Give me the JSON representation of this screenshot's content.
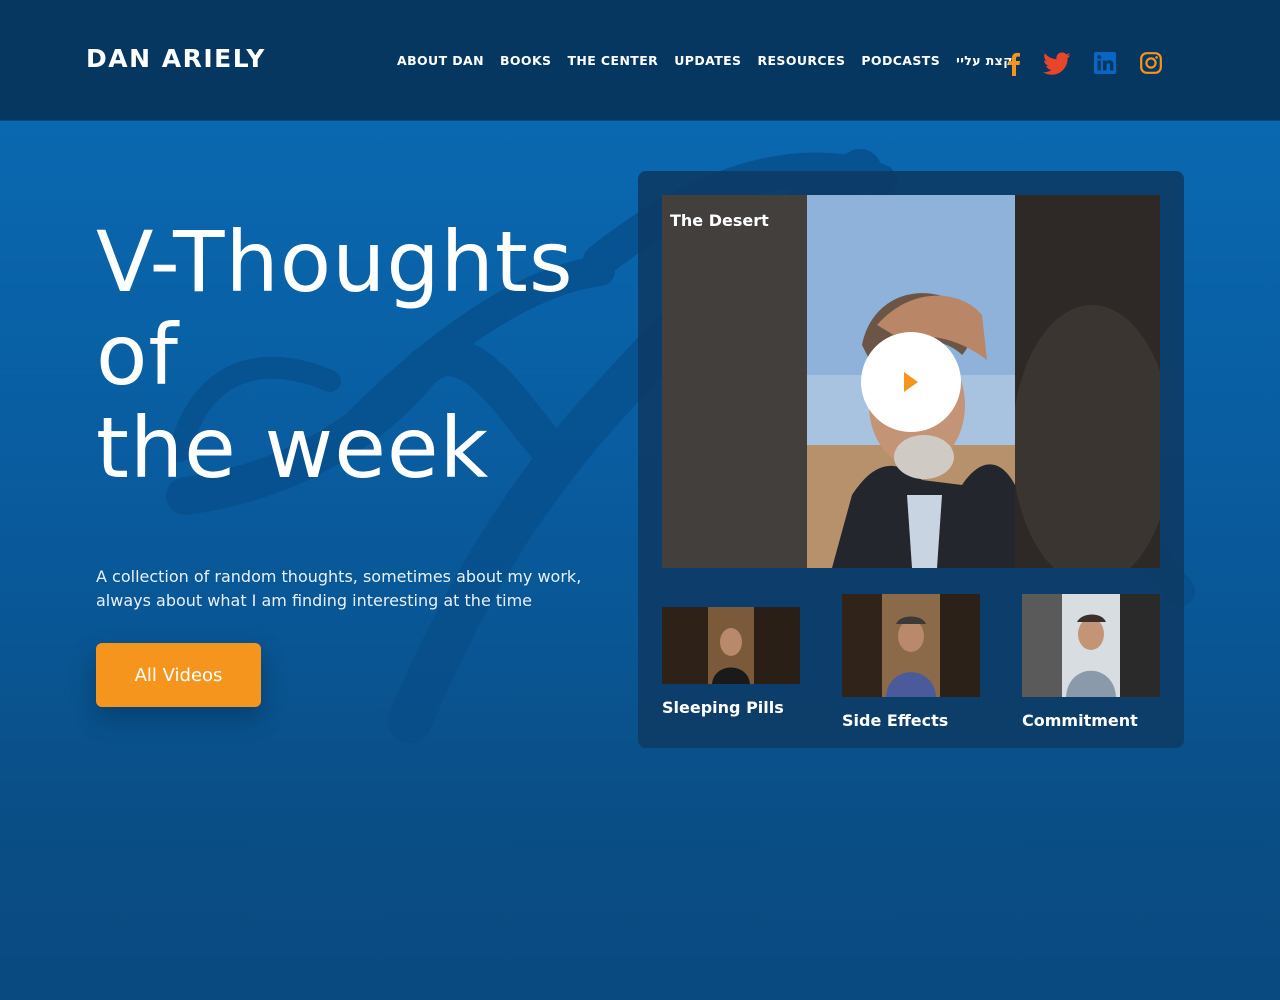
{
  "header": {
    "logo": "DAN ARIELY",
    "nav": [
      "ABOUT DAN",
      "BOOKS",
      "THE CENTER",
      "UPDATES",
      "RESOURCES",
      "PODCASTS",
      "קצת עליי"
    ],
    "social": [
      "facebook-icon",
      "twitter-icon",
      "linkedin-icon",
      "instagram-icon"
    ]
  },
  "hero": {
    "title_lines": [
      "V-Thoughts",
      "of",
      "the week"
    ],
    "description": "A collection of random thoughts, sometimes about my work, always about what I am finding interesting at the time",
    "button": "All Videos"
  },
  "videos": {
    "featured": {
      "title": "The Desert"
    },
    "thumbnails": [
      {
        "label": "Sleeping Pills"
      },
      {
        "label": "Side Effects"
      },
      {
        "label": "Commitment"
      }
    ]
  },
  "colors": {
    "header_bg": "#053761",
    "hero_blue": "#0a68b0",
    "accent_orange": "#f6951e",
    "twitter_red": "#e9452a",
    "linkedin_blue": "#0a66c2"
  }
}
